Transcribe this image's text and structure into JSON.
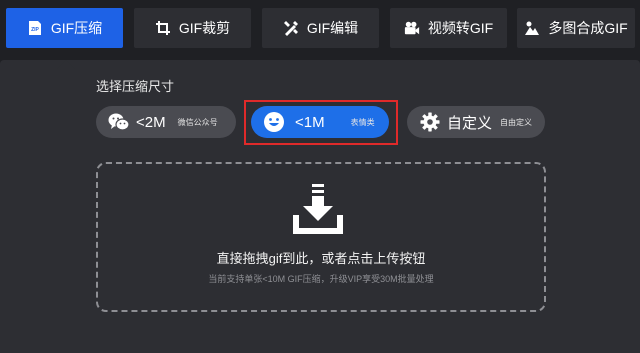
{
  "tabs": [
    {
      "label": "GIF压缩",
      "icon": "zip-file-icon",
      "active": true
    },
    {
      "label": "GIF裁剪",
      "icon": "crop-icon",
      "active": false
    },
    {
      "label": "GIF编辑",
      "icon": "edit-tools-icon",
      "active": false
    },
    {
      "label": "视频转GIF",
      "icon": "video-camera-icon",
      "active": false
    },
    {
      "label": "多图合成GIF",
      "icon": "image-icon",
      "active": false
    }
  ],
  "zip_icon_text": "ZIP",
  "section_title": "选择压缩尺寸",
  "size_options": [
    {
      "main": "<2M",
      "sub": "微信公众号",
      "icon": "wechat-icon",
      "selected": false
    },
    {
      "main": "<1M",
      "sub": "表情类",
      "icon": "smiley-icon",
      "selected": true
    },
    {
      "main": "自定义",
      "sub": "自由定义",
      "icon": "gear-icon",
      "selected": false
    }
  ],
  "dropzone": {
    "text": "直接拖拽gif到此，或者点击上传按钮",
    "hint": "当前支持单张<10M GIF压缩，升级VIP享受30M批量处理"
  },
  "colors": {
    "accent": "#1e62e6",
    "selected_option": "#1e6fe8",
    "highlight_border": "#e02a2a",
    "panel": "#2d2e33",
    "background": "#1f2024"
  }
}
